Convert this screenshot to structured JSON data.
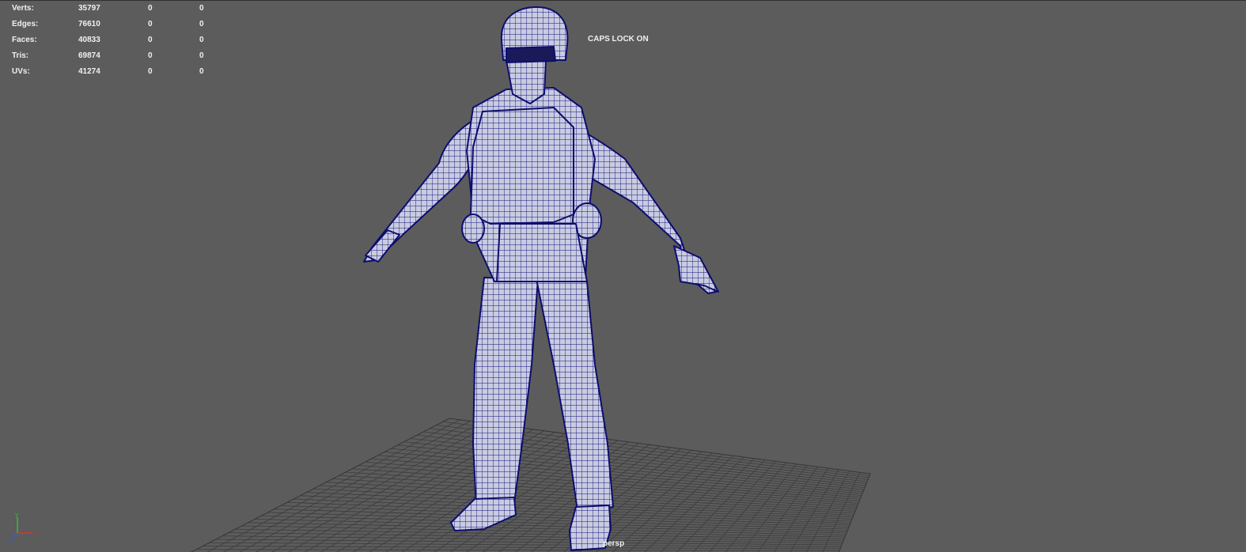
{
  "viewport": {
    "camera": "persp",
    "caps_lock": "CAPS LOCK ON"
  },
  "hud": {
    "rows": [
      {
        "label": "Verts:",
        "total": "35797",
        "selected": "0",
        "extra": "0"
      },
      {
        "label": "Edges:",
        "total": "76610",
        "selected": "0",
        "extra": "0"
      },
      {
        "label": "Faces:",
        "total": "40833",
        "selected": "0",
        "extra": "0"
      },
      {
        "label": "Tris:",
        "total": "69874",
        "selected": "0",
        "extra": "0"
      },
      {
        "label": "UVs:",
        "total": "41274",
        "selected": "0",
        "extra": "0"
      }
    ]
  },
  "colors": {
    "background": "#5c5c5c",
    "grid": "#3c3c3c",
    "wireframe": "#12127a",
    "mesh_fill": "#c9cbe0",
    "hud_text": "#f0f0f0",
    "axis_x": "#e03030",
    "axis_y": "#30c030",
    "axis_z": "#3060e0"
  },
  "icons": {
    "axis_gizmo": "xyz-axis-icon"
  }
}
